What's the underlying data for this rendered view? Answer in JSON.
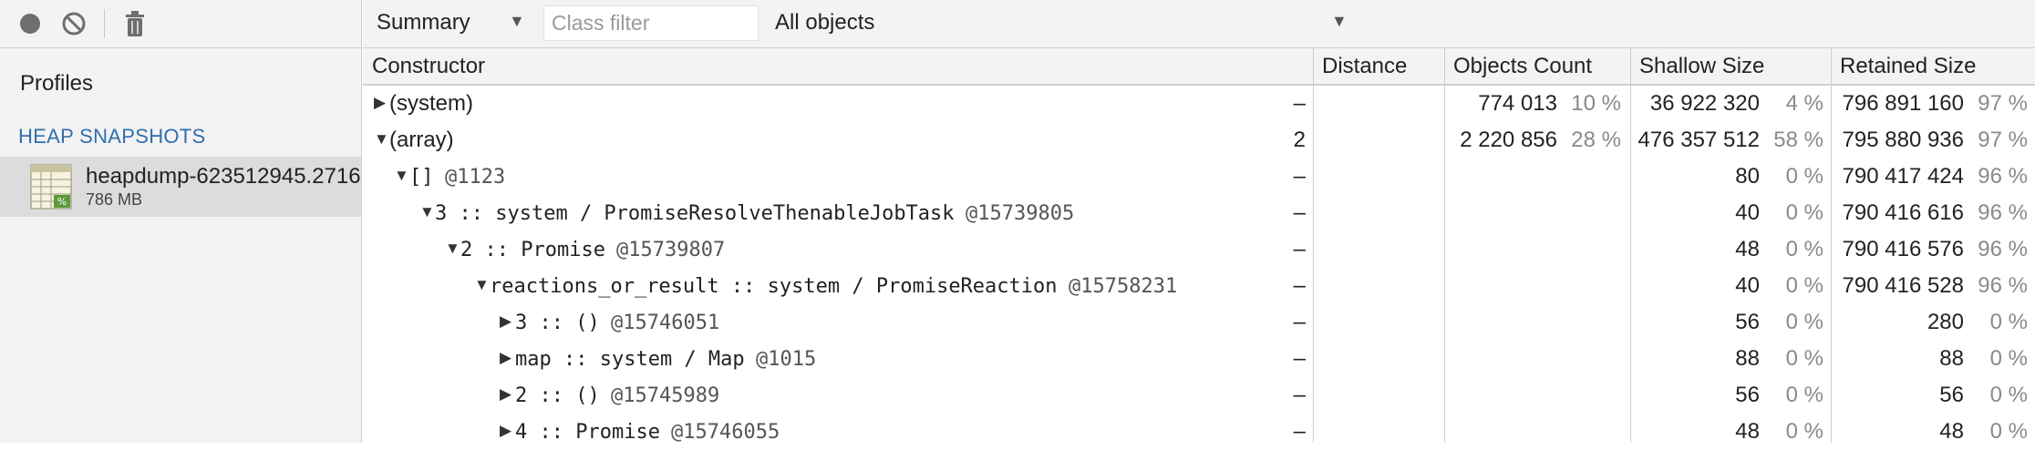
{
  "toolbar": {
    "record_icon": "record-icon",
    "clear_icon": "clear-icon",
    "trash_icon": "trash-icon"
  },
  "sidebar": {
    "profiles_label": "Profiles",
    "section_title": "HEAP SNAPSHOTS",
    "snapshot": {
      "name": "heapdump-623512945.2716",
      "size": "786 MB",
      "icon": "heap-snapshot-icon"
    }
  },
  "view": {
    "selected": "Summary",
    "class_filter_placeholder": "Class filter",
    "filter": "All objects"
  },
  "columns": {
    "constructor": "Constructor",
    "distance": "Distance",
    "objects_count": "Objects Count",
    "shallow_size": "Shallow Size",
    "retained_size": "Retained Size"
  },
  "rows": [
    {
      "label": "(system)",
      "expanded": false,
      "distance": "–",
      "objects": "774 013",
      "objects_pct": "10 %",
      "shallow": "36 922 320",
      "shallow_pct": "4 %",
      "retained": "796 891 160",
      "retained_pct": "97 %"
    },
    {
      "label": "(array)",
      "expanded": true,
      "distance": "2",
      "objects": "2 220 856",
      "objects_pct": "28 %",
      "shallow": "476 357 512",
      "shallow_pct": "58 %",
      "retained": "795 880 936",
      "retained_pct": "97 %"
    },
    {
      "label": "[]",
      "id": "@1123",
      "expanded": true,
      "distance": "–",
      "shallow": "80",
      "shallow_pct": "0 %",
      "retained": "790 417 424",
      "retained_pct": "96 %"
    },
    {
      "label": "3 :: system / PromiseResolveThenableJobTask",
      "id": "@15739805",
      "expanded": true,
      "distance": "–",
      "shallow": "40",
      "shallow_pct": "0 %",
      "retained": "790 416 616",
      "retained_pct": "96 %"
    },
    {
      "label": "2 :: Promise",
      "id": "@15739807",
      "expanded": true,
      "distance": "–",
      "shallow": "48",
      "shallow_pct": "0 %",
      "retained": "790 416 576",
      "retained_pct": "96 %"
    },
    {
      "label": "reactions_or_result :: system / PromiseReaction",
      "id": "@15758231",
      "expanded": true,
      "distance": "–",
      "shallow": "40",
      "shallow_pct": "0 %",
      "retained": "790 416 528",
      "retained_pct": "96 %"
    },
    {
      "label": "3 :: ()",
      "id": "@15746051",
      "expanded": false,
      "distance": "–",
      "shallow": "56",
      "shallow_pct": "0 %",
      "retained": "280",
      "retained_pct": "0 %"
    },
    {
      "label": "map :: system / Map",
      "id": "@1015",
      "expanded": false,
      "distance": "–",
      "shallow": "88",
      "shallow_pct": "0 %",
      "retained": "88",
      "retained_pct": "0 %"
    },
    {
      "label": "2 :: ()",
      "id": "@15745989",
      "expanded": false,
      "distance": "–",
      "shallow": "56",
      "shallow_pct": "0 %",
      "retained": "56",
      "retained_pct": "0 %"
    },
    {
      "label": "4 :: Promise",
      "id": "@15746055",
      "expanded": false,
      "distance": "–",
      "shallow": "48",
      "shallow_pct": "0 %",
      "retained": "48",
      "retained_pct": "0 %"
    }
  ]
}
